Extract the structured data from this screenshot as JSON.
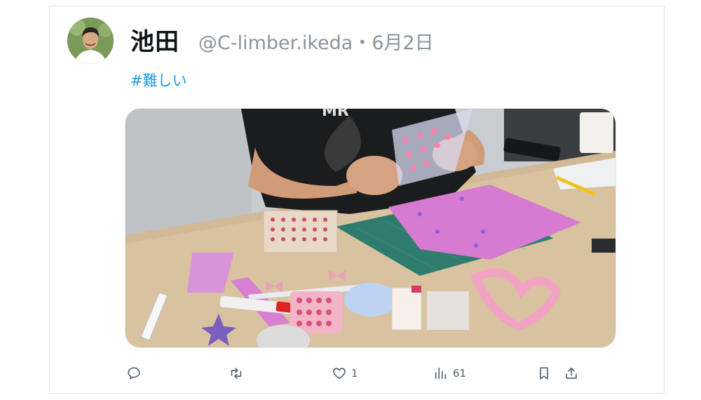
{
  "tweet": {
    "author_name": "池田",
    "handle": "@C-limber.ikeda",
    "separator": "・",
    "date": "6月2日",
    "text": "#難しい"
  },
  "actions": {
    "reply": {
      "icon": "reply-icon"
    },
    "retweet": {
      "icon": "retweet-icon"
    },
    "like": {
      "icon": "heart-icon",
      "count": "1"
    },
    "views": {
      "icon": "views-icon",
      "count": "61"
    },
    "bookmark": {
      "icon": "bookmark-icon"
    },
    "share": {
      "icon": "share-icon"
    }
  },
  "colors": {
    "link": "#1d9bf0",
    "muted": "#536471",
    "handle": "#8a949c"
  }
}
